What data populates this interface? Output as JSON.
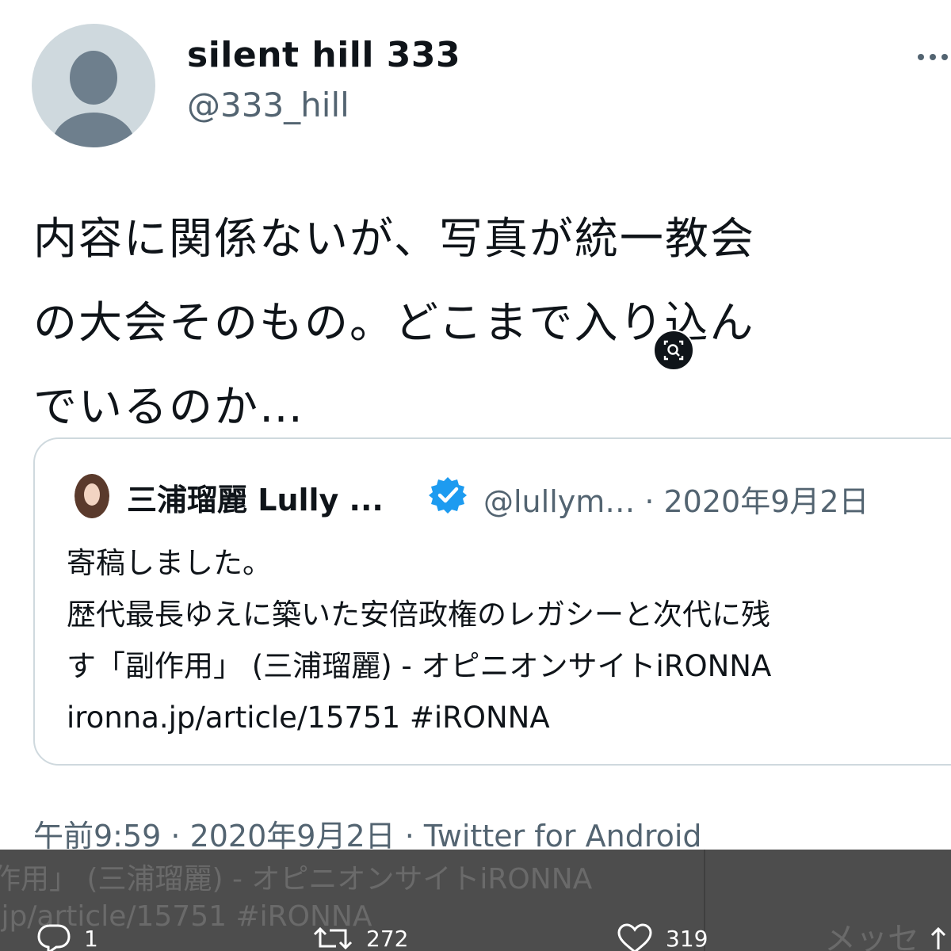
{
  "tweet": {
    "display_name": "silent hill 333",
    "handle": "@333_hill",
    "text_lines": [
      "内容に関係ないが、写真が統一教会",
      "の大会そのもの。どこまで入り込ん",
      "でいるのか…"
    ],
    "footer": "午前9:59 · 2020年9月2日 · Twitter for Android"
  },
  "quote": {
    "name": "三浦瑠麗 Lully ...",
    "meta": "@lullym… · 2020年9月2日",
    "lines": [
      "寄稿しました。",
      "歴代最長ゆえに築いた安倍政権のレガシーと次代に残",
      "す「副作用」 (三浦瑠麗) - オピニオンサイトiRONNA",
      "ironna.jp/article/15751 #iRONNA"
    ]
  },
  "overlay": {
    "ghost_line_1": "作用」 (三浦瑠麗) - オピニオンサイトiRONNA",
    "ghost_line_2": ".jp/article/15751 #iRONNA",
    "ghost_message": "メッセ",
    "reply_count": "1",
    "retweet_count": "272",
    "like_count": "319"
  },
  "icons": {
    "more": "more-dots-icon",
    "zoom": "zoom-icon",
    "verified": "verified-badge-icon",
    "reply": "reply-icon",
    "retweet": "retweet-icon",
    "like": "heart-icon",
    "share": "share-icon"
  },
  "colors": {
    "verified": "#1d9bf0",
    "secondary_text": "#536471",
    "overlay_bar": "#4d4d4d"
  }
}
